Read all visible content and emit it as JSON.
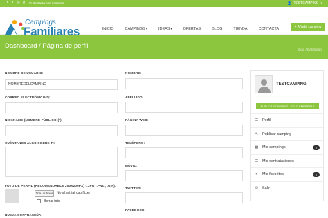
{
  "topbar": {
    "social_icons": [
      "facebook-icon",
      "twitter-icon",
      "instagram-icon",
      "googleplus-icon"
    ],
    "contact": "Contacta con nosotros",
    "user": "TESTCAMPING"
  },
  "header": {
    "logo_line1": "Campings",
    "logo_line2": "Familiares",
    "nav": [
      {
        "label": "INICIO"
      },
      {
        "label": "CAMPINGS"
      },
      {
        "label": "IDEAS"
      },
      {
        "label": "OFERTAS"
      },
      {
        "label": "BLOG"
      },
      {
        "label": "TIENDA"
      },
      {
        "label": "CONTACTA"
      }
    ],
    "cta": "+ Añadir camping"
  },
  "banner": {
    "title": "Dashboard / Página de perfil",
    "crumb_home": "Inicio",
    "crumb_sep": "/",
    "crumb_current": "Dashboard"
  },
  "form": {
    "username_label": "NOMBRE DE USUARIO:",
    "username_value": "NOMBREDELCAMPING",
    "email_label": "CORREO ELECTRÓNICO(*):",
    "nickname_label": "NICKNAME (NOMBRE PÚBLICO)(*):",
    "about_label": "CUÉNTANOS ALGO SOBRE TI:",
    "photo_label": "FOTO DE PERFIL (RECOMENDABLE 200X200PX) (.JPG, .PNG, .GIF):",
    "file_button": "Tria un fitxer",
    "file_status": "No s'ha triat cap fitxer",
    "delete_label": "Borrar foto",
    "password_label": "NUEVA CONTRASEÑA:",
    "name_label": "NOMBRE:",
    "surname_label": "APELLIDO:",
    "web_label": "PÁGINA WEB:",
    "phone_label": "TELÉFONO:",
    "mobile_label": "MÓVIL:",
    "twitter_label": "TWITTER:",
    "facebook_label": "FACEBOOK:"
  },
  "sidebar": {
    "username": "TESTCAMPING",
    "publish_button": "PUBLICAR CAMPING - SÓLO EMPRESAS",
    "menu": [
      {
        "label": "Perfil",
        "icon": "list-icon"
      },
      {
        "label": "Publicar camping",
        "icon": "pencil-icon"
      },
      {
        "label": "Mis campings",
        "icon": "grid-icon",
        "badge": "0"
      },
      {
        "label": "Mis contrataciones",
        "icon": "list-icon"
      },
      {
        "label": "Mis favoritos",
        "icon": "heart-icon",
        "badge": "0"
      },
      {
        "label": "Salir",
        "icon": "power-icon"
      }
    ]
  },
  "colors": {
    "accent": "#8cc63f",
    "logo_blue": "#2a7fb3"
  }
}
